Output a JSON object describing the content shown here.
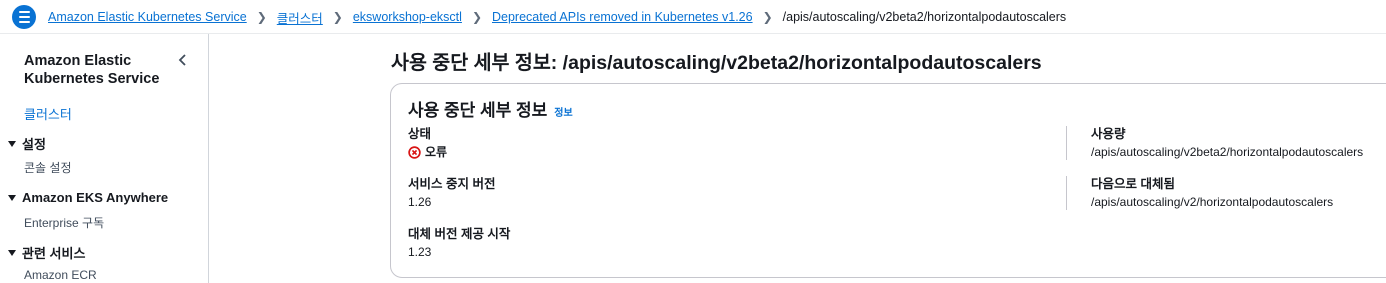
{
  "header": {
    "menu_icon": "hamburger-menu-icon",
    "breadcrumbs": [
      {
        "label": "Amazon Elastic Kubernetes Service"
      },
      {
        "label": "클러스터"
      },
      {
        "label": "eksworkshop-eksctl"
      },
      {
        "label": "Deprecated APIs removed in Kubernetes v1.26"
      }
    ],
    "current": "/apis/autoscaling/v2beta2/horizontalpodautoscalers"
  },
  "sidebar": {
    "title": "Amazon Elastic Kubernetes Service",
    "clusters_link": "클러스터",
    "sections": [
      {
        "label": "설정",
        "items": [
          "콘솔 설정"
        ]
      },
      {
        "label": "Amazon EKS Anywhere",
        "items": [
          "Enterprise 구독"
        ]
      },
      {
        "label": "관련 서비스",
        "items": [
          "Amazon ECR"
        ]
      }
    ]
  },
  "main": {
    "title": "사용 중단 세부 정보: /apis/autoscaling/v2beta2/horizontalpodautoscalers",
    "card": {
      "title": "사용 중단 세부 정보",
      "info_link": "정보",
      "status_label": "상태",
      "status_value": "오류",
      "deprecated_label": "서비스 중지 버전",
      "deprecated_value": "1.26",
      "replacement_start_label": "대체 버전 제공 시작",
      "replacement_start_value": "1.23",
      "usage_label": "사용량",
      "usage_value": "/apis/autoscaling/v2beta2/horizontalpodautoscalers",
      "replaced_by_label": "다음으로 대체됨",
      "replaced_by_value": "/apis/autoscaling/v2/horizontalpodautoscalers"
    }
  },
  "colors": {
    "link": "#0972d3",
    "error": "#d91515",
    "text": "#16191f"
  }
}
